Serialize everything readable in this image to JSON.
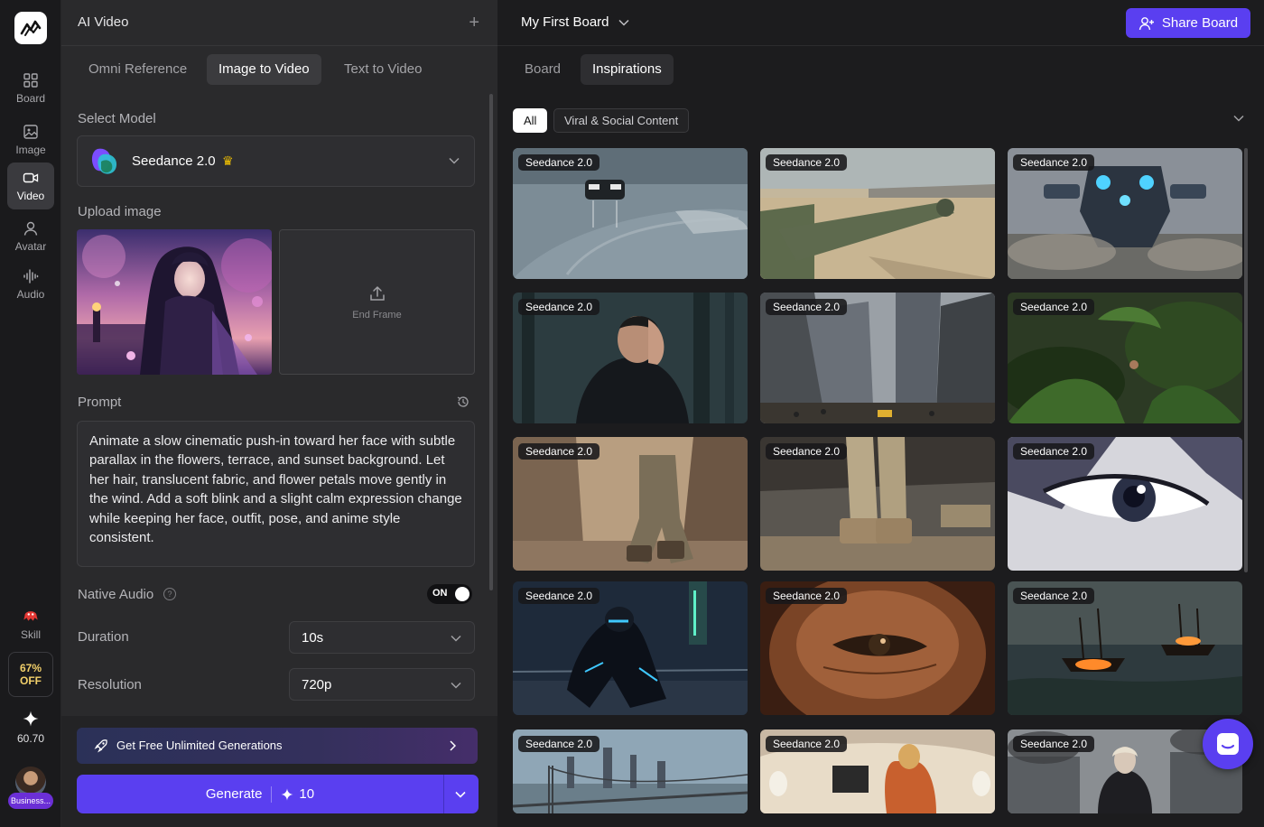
{
  "rail": {
    "items": [
      {
        "label": "Board",
        "icon": "grid-icon"
      },
      {
        "label": "Image",
        "icon": "image-icon"
      },
      {
        "label": "Video",
        "icon": "video-camera-icon",
        "active": true
      },
      {
        "label": "Avatar",
        "icon": "person-icon"
      },
      {
        "label": "Audio",
        "icon": "waveform-icon"
      }
    ],
    "skill_label": "Skill",
    "promo_line1": "67%",
    "promo_line2": "OFF",
    "credits": "60.70",
    "plan_badge": "Business..."
  },
  "panel": {
    "title": "AI Video",
    "tabs": [
      {
        "label": "Omni Reference"
      },
      {
        "label": "Image to Video",
        "active": true
      },
      {
        "label": "Text to Video"
      }
    ],
    "select_model_label": "Select Model",
    "model_name": "Seedance 2.0",
    "upload_label": "Upload image",
    "end_frame_label": "End Frame",
    "prompt_label": "Prompt",
    "prompt_text": "Animate a slow cinematic push-in toward her face with subtle parallax in the flowers, terrace, and sunset background. Let her hair, translucent fabric, and flower petals move gently in the wind. Add a soft blink and a slight calm expression change while keeping her face, outfit, pose, and anime style consistent.",
    "native_audio_label": "Native Audio",
    "native_audio_state": "ON",
    "duration_label": "Duration",
    "duration_value": "10s",
    "resolution_label": "Resolution",
    "resolution_value": "720p",
    "free_banner": "Get Free Unlimited Generations",
    "generate_label": "Generate",
    "generate_cost": "10"
  },
  "board": {
    "title": "My First Board",
    "share_label": "Share Board",
    "tabs": [
      {
        "label": "Board"
      },
      {
        "label": "Inspirations",
        "active": true
      }
    ],
    "filters": [
      {
        "label": "All",
        "active": true
      },
      {
        "label": "Viral & Social Content"
      }
    ],
    "tiles": [
      {
        "badge": "Seedance 2.0",
        "scene": "race-car-rain"
      },
      {
        "badge": "Seedance 2.0",
        "scene": "tank-desert"
      },
      {
        "badge": "Seedance 2.0",
        "scene": "mech-robot"
      },
      {
        "badge": "Seedance 2.0",
        "scene": "man-dark-forest"
      },
      {
        "badge": "Seedance 2.0",
        "scene": "city-street-skyscrapers"
      },
      {
        "badge": "Seedance 2.0",
        "scene": "jungle-foliage"
      },
      {
        "badge": "Seedance 2.0",
        "scene": "soldiers-alley"
      },
      {
        "badge": "Seedance 2.0",
        "scene": "boots-aircraft"
      },
      {
        "badge": "Seedance 2.0",
        "scene": "anime-eye"
      },
      {
        "badge": "Seedance 2.0",
        "scene": "cyber-ninja"
      },
      {
        "badge": "Seedance 2.0",
        "scene": "eye-closeup"
      },
      {
        "badge": "Seedance 2.0",
        "scene": "ships-burning-sea"
      },
      {
        "badge": "Seedance 2.0",
        "scene": "bridge-skyline"
      },
      {
        "badge": "Seedance 2.0",
        "scene": "private-jet-cabin"
      },
      {
        "badge": "Seedance 2.0",
        "scene": "woman-ruined-city"
      }
    ]
  },
  "colors": {
    "accent": "#5a3ff0",
    "crown": "#f5c400",
    "promo": "#f2d06a"
  }
}
